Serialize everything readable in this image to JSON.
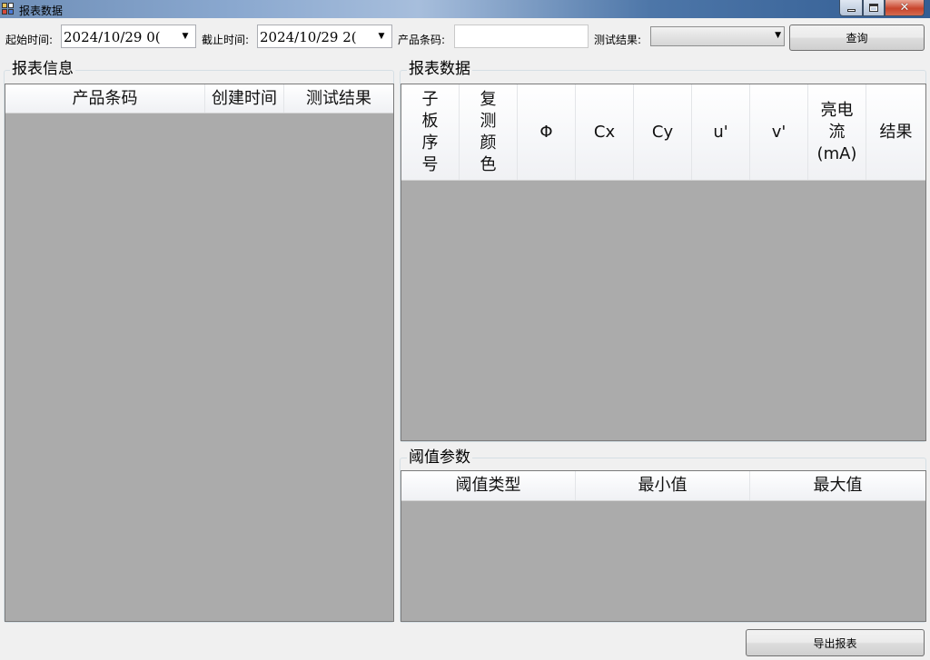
{
  "window": {
    "title": "报表数据",
    "controls": {
      "minimize": "minimize-icon",
      "maximize": "maximize-icon",
      "close": "✕"
    }
  },
  "filters": {
    "start_label": "起始时间:",
    "start_value": "2024/10/29 0(",
    "end_label": "截止时间:",
    "end_value": "2024/10/29 2(",
    "barcode_label": "产品条码:",
    "barcode_value": "",
    "result_label": "测试结果:",
    "result_value": "",
    "query_button": "查询",
    "dropdown_arrow": "▼"
  },
  "report_info": {
    "title": "报表信息",
    "columns": [
      "产品条码",
      "创建时间",
      "测试结果"
    ],
    "rows": []
  },
  "report_data": {
    "title": "报表数据",
    "columns": [
      "子板序号",
      "复测颜色",
      "Φ",
      "Cx",
      "Cy",
      "u'",
      "v'",
      "亮电流(mA)",
      "结果"
    ],
    "rows": []
  },
  "thresholds": {
    "title": "阈值参数",
    "columns": [
      "阈值类型",
      "最小值",
      "最大值"
    ],
    "rows": []
  },
  "footer": {
    "export_button": "导出报表"
  }
}
